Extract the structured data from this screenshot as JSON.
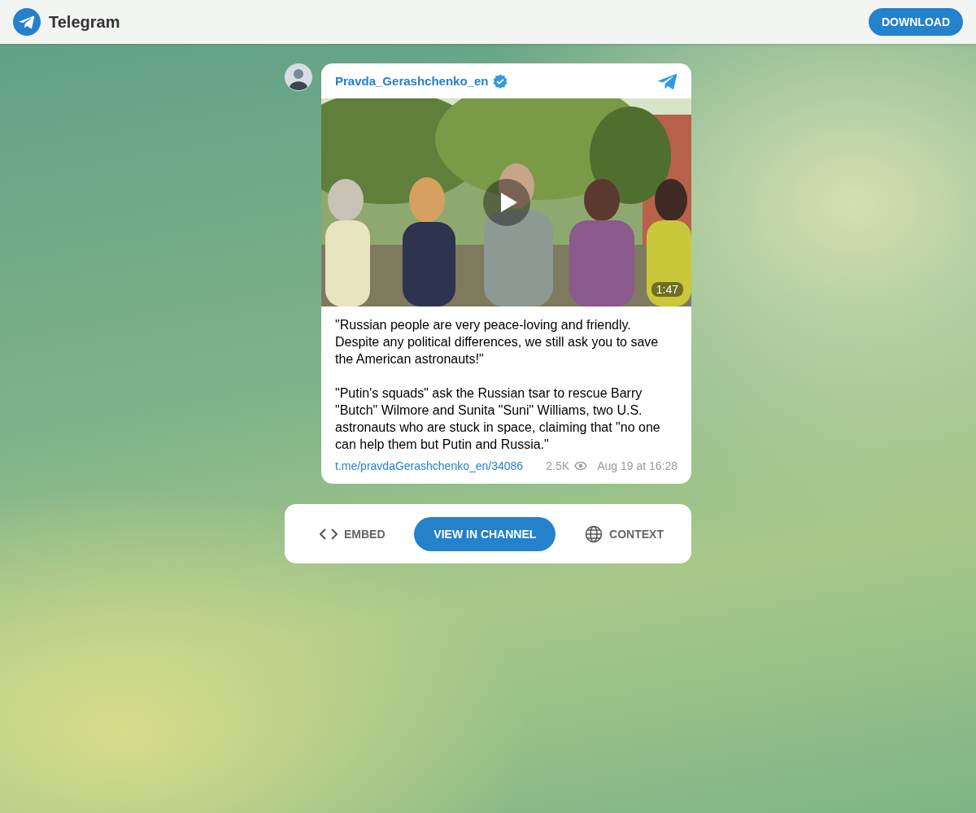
{
  "header": {
    "app_name": "Telegram",
    "download_button": "DOWNLOAD"
  },
  "post": {
    "channel_name": "Pravda_Gerashchenko_en",
    "verified": true,
    "video": {
      "duration": "1:47"
    },
    "paragraphs": [
      "\"Russian people are very peace-loving and friendly. Despite any political differences, we still ask you to save the American astronauts!\"",
      "\"Putin's squads\" ask the Russian tsar to rescue Barry \"Butch\" Wilmore and Sunita \"Suni\" Williams, two U.S. astronauts who are stuck in space, claiming that \"no one can help them but Putin and Russia.\""
    ],
    "link": "t.me/pravdaGerashchenko_en/34086",
    "views": "2.5K",
    "date": "Aug 19 at 16:28"
  },
  "actions": [
    {
      "kind": "embed",
      "label": "EMBED",
      "primary": false
    },
    {
      "kind": "view",
      "label": "VIEW IN CHANNEL",
      "primary": true
    },
    {
      "kind": "context",
      "label": "CONTEXT",
      "primary": false
    }
  ]
}
